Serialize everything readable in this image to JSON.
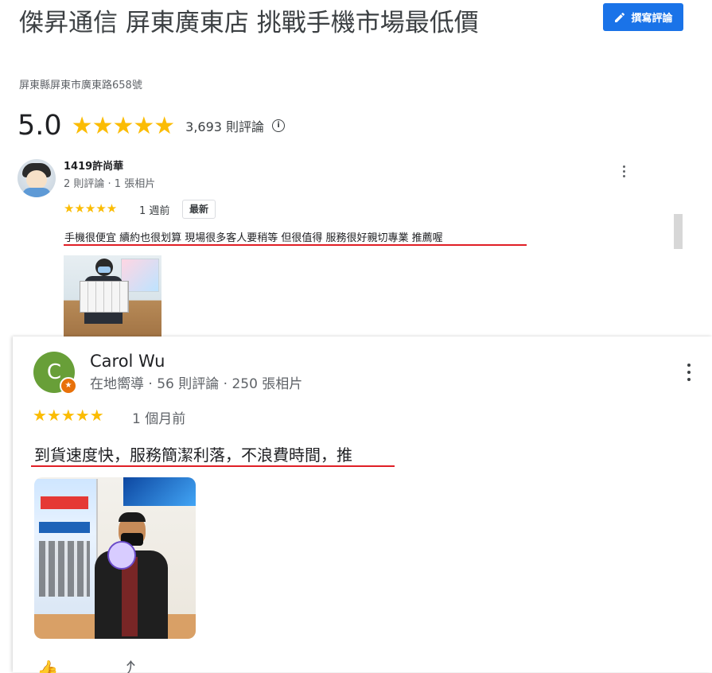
{
  "place": {
    "title": "傑昇通信 屏東廣東店 挑戰手機市場最低價",
    "address": "屏東縣屏東市廣東路658號",
    "rating": "5.0",
    "stars": "★★★★★",
    "review_count": "3,693 則評論",
    "write_review_label": "撰寫評論"
  },
  "reviews": [
    {
      "name": "1419許尚華",
      "meta": "2 則評論 · 1 張相片",
      "stars": "★★★★★",
      "time": "1 週前",
      "badge": "最新",
      "text": "手機很便宜 續約也很划算 現場很多客人要稍等 但很值得 服務很好親切專業 推薦喔"
    },
    {
      "name": "Carol Wu",
      "avatar_letter": "C",
      "meta": "在地嚮導 · 56 則評論 · 250 張相片",
      "stars": "★★★★★",
      "time": "1 個月前",
      "text": "到貨速度快，服務簡潔利落，不浪費時間，推"
    }
  ],
  "colors": {
    "star": "#fbbc04",
    "primary_button": "#1a73e8",
    "underline": "#e01f26",
    "avatar_green": "#689f38",
    "local_guide_badge": "#e8710a"
  },
  "icons": [
    "edit-icon",
    "info-icon",
    "more-vert-icon",
    "local-guide-badge-icon",
    "like-icon",
    "share-icon"
  ]
}
